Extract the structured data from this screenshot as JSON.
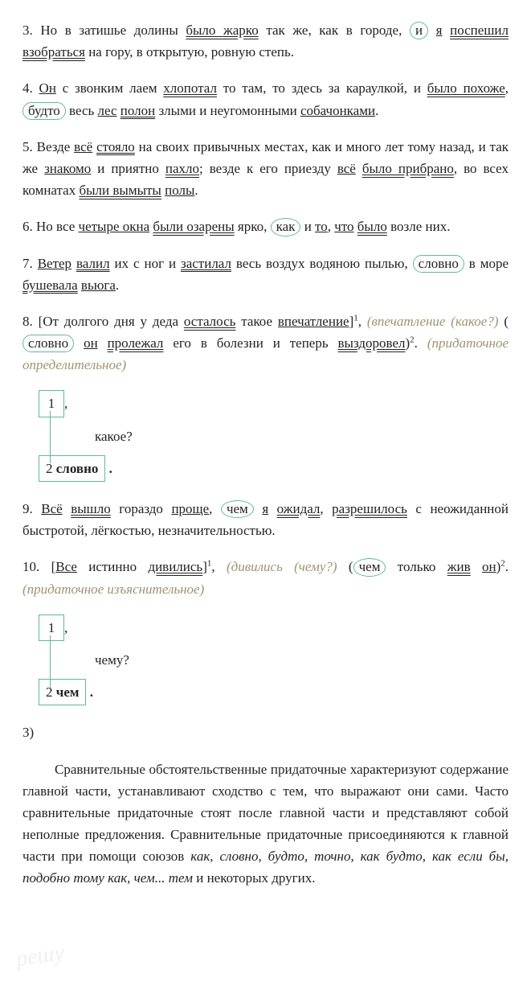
{
  "p3": {
    "t1": "3. Но в затишье долины ",
    "t2": "было жарко",
    "t3": " так же, как в городе, ",
    "t4": "и",
    "t5": " ",
    "t6": "я",
    "t7": " ",
    "t8": "поспешил взобраться",
    "t9": " на гору, в открытую, ровную степь."
  },
  "p4": {
    "t1": "4. ",
    "t2": "Он",
    "t3": " с звонким лаем ",
    "t4": "хлопотал",
    "t5": " то там, то здесь за караулкой, и ",
    "t6": "было похоже",
    "t7": ", ",
    "t8": "будто",
    "t9": " весь ",
    "t10": "лес",
    "t11": " ",
    "t12": "полон",
    "t13": " злыми и неугомонными ",
    "t14": "собачонками",
    "t15": "."
  },
  "p5": {
    "t1": "5. Везде ",
    "t2": "всё",
    "t3": " ",
    "t4": "стояло",
    "t5": " на своих привычных местах, как и много лет тому назад, и так же ",
    "t6": "знакомо",
    "t7": " и приятно ",
    "t8": "пахло",
    "t9": "; везде к его приезду ",
    "t10": "всё",
    "t11": " ",
    "t12": "было прибрано",
    "t13": ", во всех комнатах ",
    "t14": "были вымыты",
    "t15": " ",
    "t16": "полы",
    "t17": "."
  },
  "p6": {
    "t1": "6. Но все ",
    "t2": "четыре окна",
    "t3": " ",
    "t4": "были озарены",
    "t5": " ярко, ",
    "t6": "как",
    "t7": " и ",
    "t8": "то",
    "t9": ", ",
    "t10": "что",
    "t11": " ",
    "t12": "было",
    "t13": " возле них."
  },
  "p7": {
    "t1": "7. ",
    "t2": "Ветер",
    "t3": " ",
    "t4": "валил",
    "t5": " их с ног и ",
    "t6": "застилал",
    "t7": " весь воздух водяною пылью, ",
    "t8": "словно",
    "t9": " в море ",
    "t10": "бушевала",
    "t11": " ",
    "t12": "вьюга",
    "t13": "."
  },
  "p8": {
    "t1": "8. [От долгого дня у деда ",
    "t2": "осталось",
    "t3": " такое ",
    "t4": "впечатление",
    "t5": "]",
    "s1": "1",
    "t6": ", ",
    "n1": "(впечатление (какое?)",
    "t7": " (",
    "t8": "словно",
    "t9": " ",
    "t10": "он",
    "t11": " ",
    "t12": "пролежал",
    "t13": " его в болезни и теперь ",
    "t14": "выздоровел",
    "t15": ")",
    "s2": "2",
    "t16": ". ",
    "n2": "(придаточное определительное)"
  },
  "d8": {
    "b1": "1",
    "comma": ",",
    "q": "какое?",
    "b2": "2",
    "w": "словно",
    "dot": "."
  },
  "p9": {
    "t1": "9. ",
    "t2": "Всё",
    "t3": " ",
    "t4": "вышло",
    "t5": " гораздо ",
    "t6": "проще",
    "t7": ", ",
    "t8": "чем",
    "t9": " ",
    "t10": "я",
    "t11": " ",
    "t12": "ожидал",
    "t13": ", ",
    "t14": "разрешилось",
    "t15": " с неожиданной быстротой, лёгкостью, незначительностью."
  },
  "p10": {
    "t1": "10. [",
    "t2": "Все",
    "t3": " истинно ",
    "t4": "дивились",
    "t5": "]",
    "s1": "1",
    "t6": ", ",
    "n1": "(дивились (чему?)",
    "t7": " (",
    "t8": "чем",
    "t9": " только ",
    "t10": "жив",
    "t11": " ",
    "t12": "он",
    "t13": ")",
    "s2": "2",
    "t14": ". ",
    "n2": "(придаточное изъяснительное)"
  },
  "d10": {
    "b1": "1",
    "comma": ",",
    "q": "чему?",
    "b2": "2",
    "w": "чем",
    "dot": "."
  },
  "sec3": "3)",
  "para": {
    "t1": "Сравнительные обстоятельственные придаточные характеризуют содержание главной части, устанавливают сходство с тем, что выражают они сами. Часто сравнительные придаточные стоят после главной части и представляют собой неполные предложения. Сравнительные придаточные присоединяются к главной части при помощи союзов ",
    "t2": "как, словно, будто, точно, как будто, как если бы, подобно тому как, чем... тем",
    "t3": " и некоторых других."
  },
  "wm": "решу"
}
